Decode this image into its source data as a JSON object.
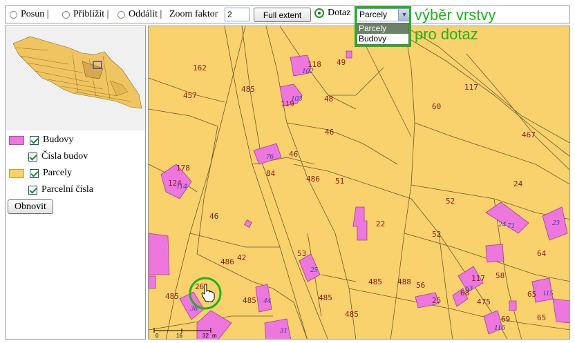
{
  "toolbar": {
    "mode_posun": "Posun |",
    "mode_priblizit": "Přiblížit |",
    "mode_oddalit": "Oddálit |",
    "zoom_label": "Zoom faktor",
    "zoom_value": "2",
    "full_extent": "Full extent",
    "mode_dotaz": "Dotaz",
    "layer_selected": "Parcely",
    "layer_options": [
      "Parcely",
      "Budovy"
    ]
  },
  "annotation": {
    "line1": "výběr vrstvy",
    "line2": "pro dotaz",
    "color": "#1fb31f"
  },
  "legend": {
    "budovy": "Budovy",
    "cisla_budov": "Čísla budov",
    "parcely": "Parcely",
    "parcelni_cisla": "Parcelní čísla",
    "budovy_color": "#ee77dd",
    "parcely_color": "#f9d16d"
  },
  "refresh_button": "Obnovit",
  "scale_bar": {
    "ticks": [
      "0",
      "16",
      "32"
    ],
    "unit": "m"
  },
  "map_labels": {
    "parcels": [
      "162",
      "118",
      "49",
      "457",
      "485",
      "48",
      "119",
      "117",
      "60",
      "46",
      "467",
      "46",
      "84",
      "178",
      "486",
      "51",
      "124",
      "24",
      "52",
      "46",
      "22",
      "52",
      "42",
      "486",
      "53",
      "64",
      "485",
      "488",
      "56",
      "117",
      "58",
      "26",
      "485",
      "485",
      "65",
      "475",
      "485",
      "25",
      "68",
      "69",
      "65"
    ],
    "buildings": [
      "102",
      "103",
      "76",
      "114",
      "25",
      "63",
      "44",
      "24",
      "71",
      "23",
      "115",
      "116",
      "31",
      "38"
    ]
  }
}
